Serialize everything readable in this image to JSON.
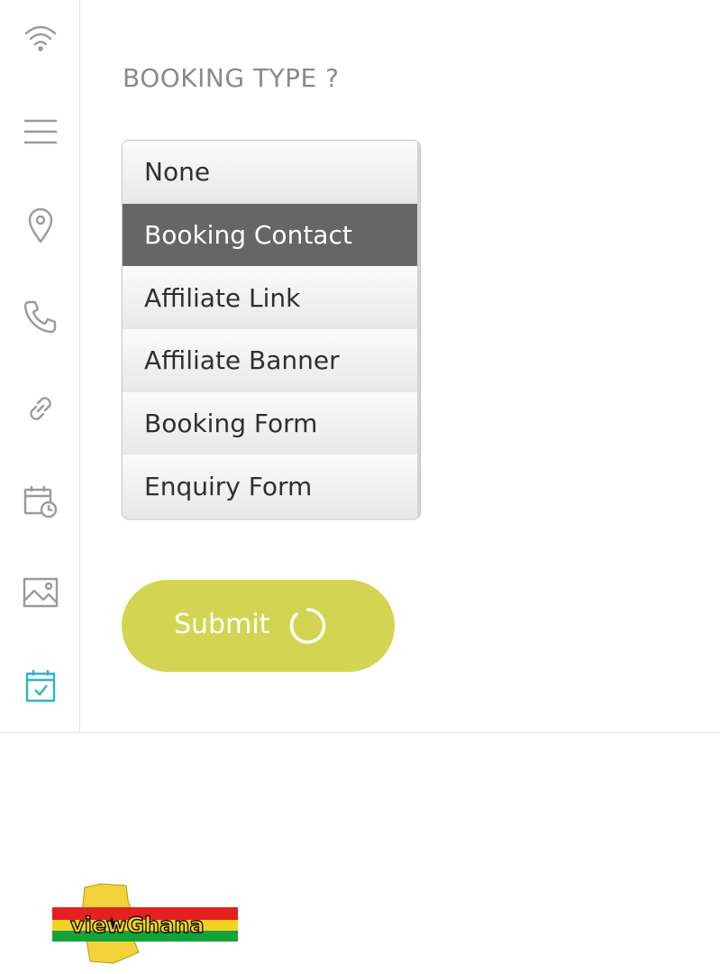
{
  "sidebar": {
    "icons": [
      "wifi-icon",
      "menu-icon",
      "location-pin-icon",
      "phone-icon",
      "link-icon",
      "calendar-clock-icon",
      "image-icon",
      "calendar-check-icon"
    ],
    "active_icon": "calendar-check-icon",
    "icon_color": "#9a9a9a",
    "active_color": "#2bb5c8"
  },
  "form": {
    "heading": "BOOKING TYPE ?",
    "options": [
      "None",
      "Booking Contact",
      "Affiliate Link",
      "Affiliate Banner",
      "Booking Form",
      "Enquiry Form"
    ],
    "selected": "Booking Contact",
    "submit_label": "Submit",
    "submit_color": "#d3d552"
  },
  "logo": {
    "text": "viewGhana"
  }
}
